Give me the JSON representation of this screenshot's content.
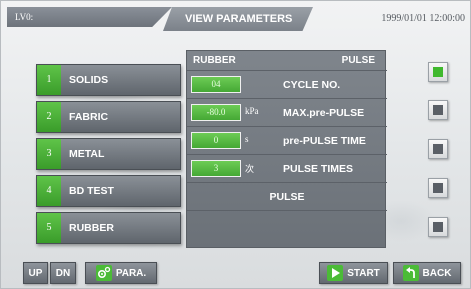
{
  "header": {
    "level": "LV0:",
    "title": "VIEW PARAMETERS",
    "datetime": "1999/01/01 12:00:00"
  },
  "modes": [
    {
      "num": "1",
      "label": "SOLIDS"
    },
    {
      "num": "2",
      "label": "FABRIC"
    },
    {
      "num": "3",
      "label": "METAL"
    },
    {
      "num": "4",
      "label": "BD TEST"
    },
    {
      "num": "5",
      "label": "RUBBER"
    }
  ],
  "panel": {
    "mode_title": "RUBBER",
    "cycle_type": "PULSE",
    "rows": [
      {
        "value": "04",
        "unit": "",
        "label": "CYCLE NO."
      },
      {
        "value": "-80.0",
        "unit": "kPa",
        "label": "MAX.pre-PULSE"
      },
      {
        "value": "0",
        "unit": "s",
        "label": "pre-PULSE TIME"
      },
      {
        "value": "3",
        "unit": "次",
        "label": "PULSE TIMES"
      }
    ],
    "pulse_label": "PULSE"
  },
  "indicators": [
    {
      "name": "indicator-1",
      "active": true
    },
    {
      "name": "indicator-2",
      "active": false
    },
    {
      "name": "indicator-3",
      "active": false
    },
    {
      "name": "indicator-4",
      "active": false
    },
    {
      "name": "indicator-5",
      "active": false
    }
  ],
  "footer": {
    "up_label": "UP",
    "dn_label": "DN",
    "para_label": "PARA.",
    "start_label": "START",
    "back_label": "BACK",
    "para_icon": "gears-icon",
    "start_icon": "play-icon",
    "back_icon": "return-arrow-icon"
  },
  "colors": {
    "accent_green": "#4bbb37",
    "panel_gray": "#757b82"
  }
}
